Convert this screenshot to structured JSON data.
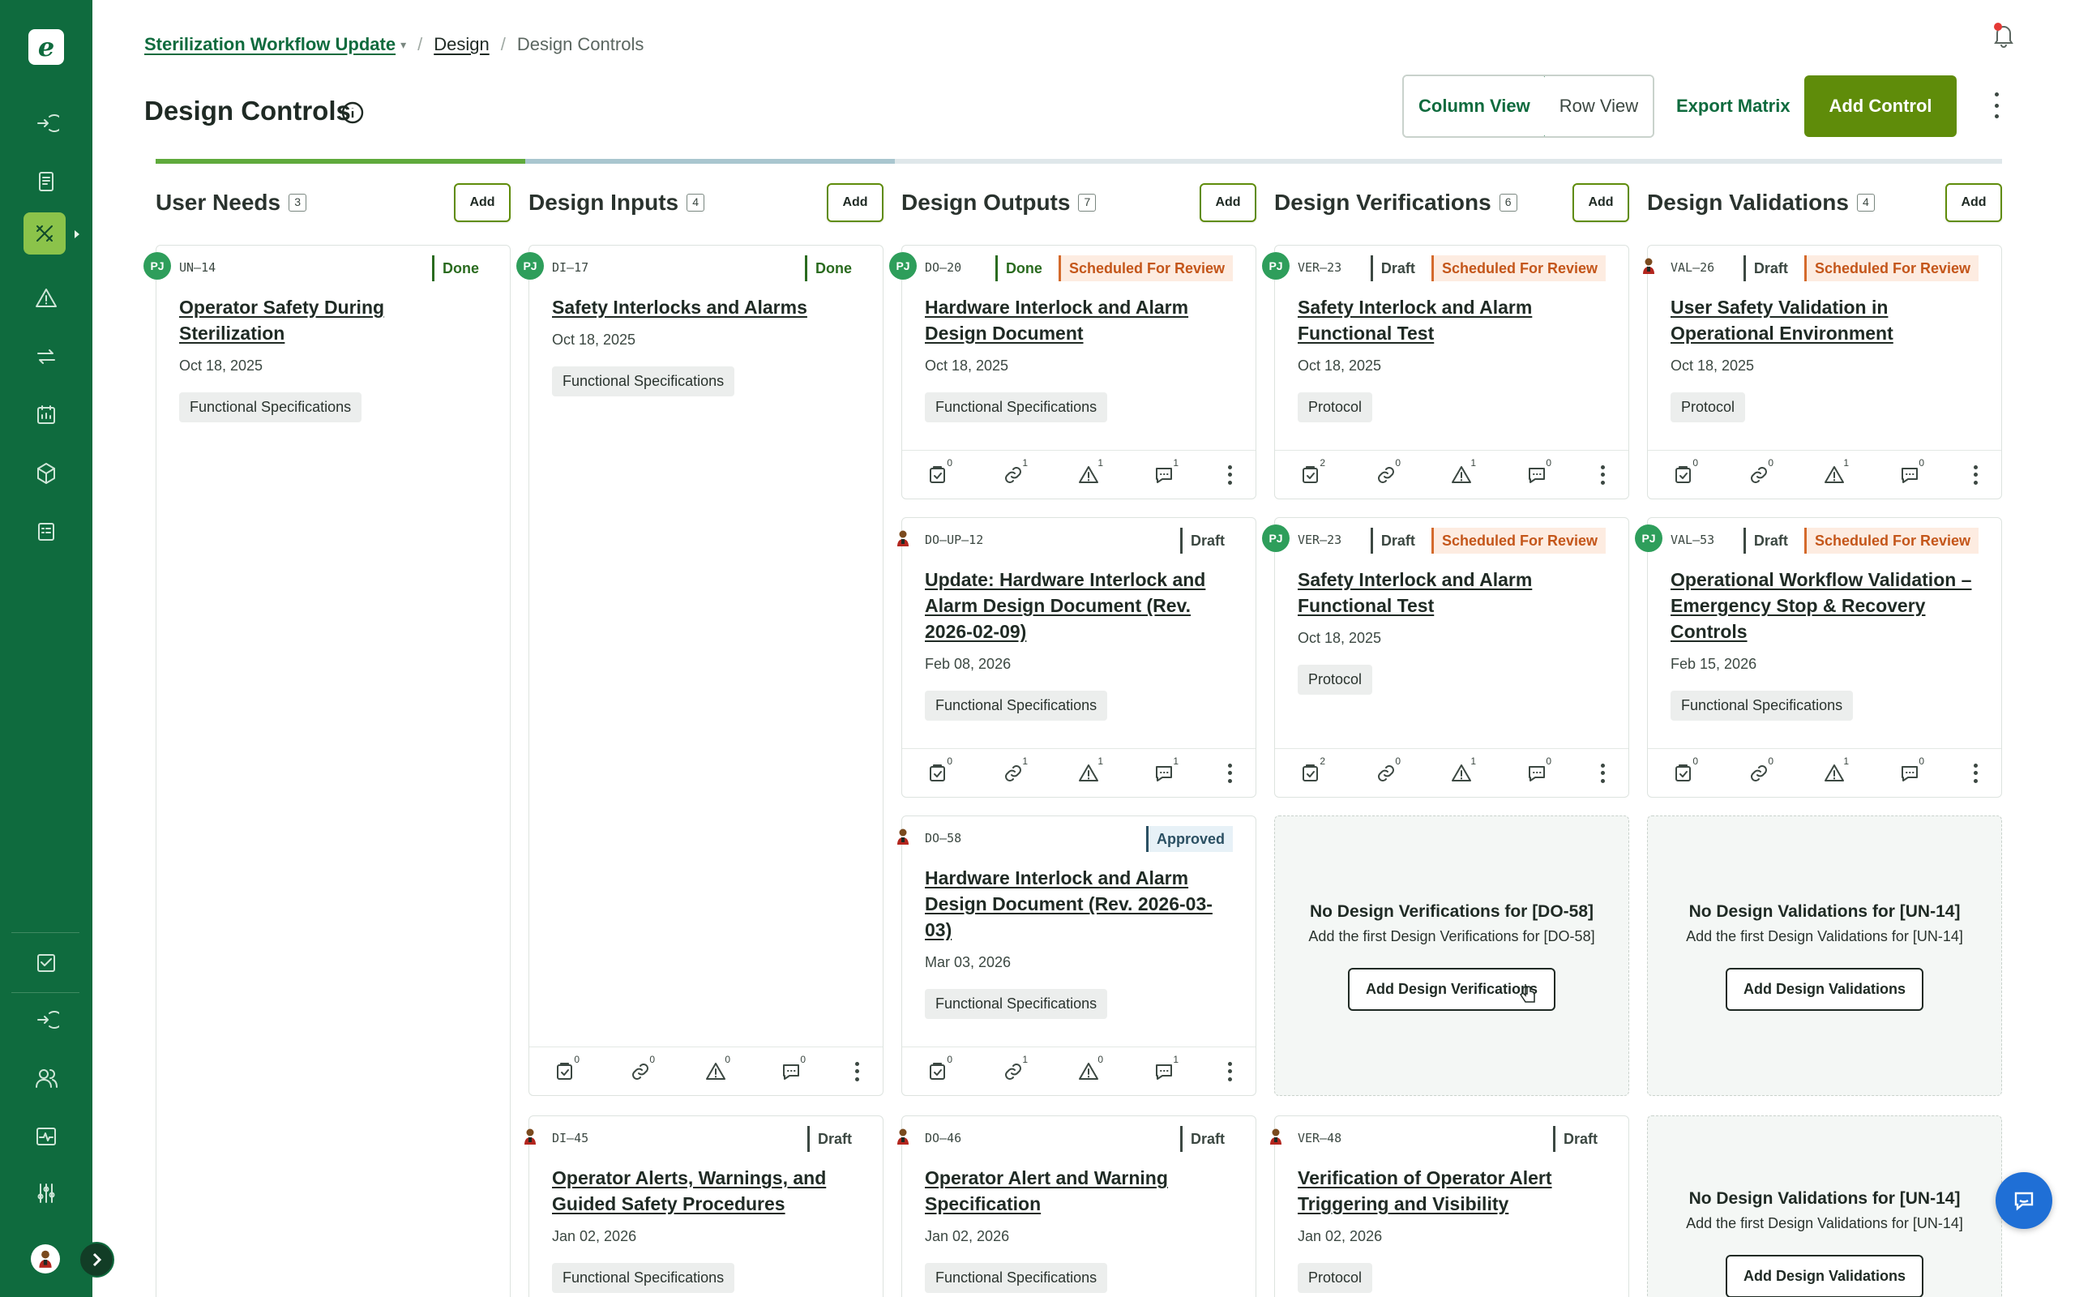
{
  "app": {
    "logo_letter": "e",
    "colors": {
      "sidebar": "#0f6b3e",
      "accent": "#5f8c0a",
      "review": "#d46a2c"
    }
  },
  "breadcrumb": {
    "project": "Sterilization Workflow Update",
    "section": "Design",
    "current": "Design Controls"
  },
  "header": {
    "title": "Design Controls",
    "column_view": "Column View",
    "row_view": "Row View",
    "export": "Export Matrix",
    "add_control": "Add Control"
  },
  "columns": [
    {
      "title": "User Needs",
      "count": "3",
      "add": "Add"
    },
    {
      "title": "Design Inputs",
      "count": "4",
      "add": "Add"
    },
    {
      "title": "Design Outputs",
      "count": "7",
      "add": "Add"
    },
    {
      "title": "Design Verifications",
      "count": "6",
      "add": "Add"
    },
    {
      "title": "Design Validations",
      "count": "4",
      "add": "Add"
    }
  ],
  "cards": {
    "un14": {
      "avatar": "PJ",
      "id": "UN–14",
      "status": "Done",
      "title": "Operator Safety During Sterilization",
      "date": "Oct 18, 2025",
      "tag": "Functional Specifications"
    },
    "di17": {
      "avatar": "PJ",
      "id": "DI–17",
      "status": "Done",
      "title": "Safety Interlocks and Alarms",
      "date": "Oct 18, 2025",
      "tag": "Functional Specifications",
      "counts": [
        "0",
        "0",
        "0",
        "0"
      ]
    },
    "di45": {
      "id": "DI–45",
      "status": "Draft",
      "title": "Operator Alerts, Warnings, and Guided Safety Procedures",
      "date": "Jan 02, 2026",
      "tag": "Functional Specifications"
    },
    "do20": {
      "avatar": "PJ",
      "id": "DO–20",
      "status": "Done",
      "review": "Scheduled For Review",
      "title": "Hardware Interlock and Alarm Design Document",
      "date": "Oct 18, 2025",
      "tag": "Functional Specifications",
      "counts": [
        "0",
        "1",
        "1",
        "1"
      ]
    },
    "doup12": {
      "id": "DO–UP–12",
      "status": "Draft",
      "title": "Update: Hardware Interlock and Alarm Design Document (Rev. 2026-02-09)",
      "date": "Feb 08, 2026",
      "tag": "Functional Specifications",
      "counts": [
        "0",
        "1",
        "1",
        "1"
      ]
    },
    "do58": {
      "id": "DO–58",
      "status": "Approved",
      "title": "Hardware Interlock and Alarm Design Document (Rev. 2026-03-03)",
      "date": "Mar 03, 2026",
      "tag": "Functional Specifications",
      "counts": [
        "0",
        "1",
        "0",
        "1"
      ]
    },
    "do46": {
      "id": "DO–46",
      "status": "Draft",
      "title": "Operator Alert and Warning Specification",
      "date": "Jan 02, 2026",
      "tag": "Functional Specifications"
    },
    "ver23a": {
      "avatar": "PJ",
      "id": "VER–23",
      "status": "Draft",
      "review": "Scheduled For Review",
      "title": "Safety Interlock and Alarm Functional Test",
      "date": "Oct 18, 2025",
      "tag": "Protocol",
      "counts": [
        "2",
        "0",
        "1",
        "0"
      ]
    },
    "ver23b": {
      "avatar": "PJ",
      "id": "VER–23",
      "status": "Draft",
      "review": "Scheduled For Review",
      "title": "Safety Interlock and Alarm Functional Test",
      "date": "Oct 18, 2025",
      "tag": "Protocol",
      "counts": [
        "2",
        "0",
        "1",
        "0"
      ]
    },
    "ver48": {
      "id": "VER–48",
      "status": "Draft",
      "title": "Verification of Operator Alert Triggering and Visibility",
      "date": "Jan 02, 2026",
      "tag": "Protocol"
    },
    "val26": {
      "id": "VAL–26",
      "status": "Draft",
      "review": "Scheduled For Review",
      "title": "User Safety Validation in Operational Environment",
      "date": "Oct 18, 2025",
      "tag": "Protocol",
      "counts": [
        "0",
        "0",
        "1",
        "0"
      ]
    },
    "val53": {
      "avatar": "PJ",
      "id": "VAL–53",
      "status": "Draft",
      "review": "Scheduled For Review",
      "title": "Operational Workflow Validation – Emergency Stop & Recovery Controls",
      "date": "Feb 15, 2026",
      "tag": "Functional Specifications",
      "counts": [
        "0",
        "0",
        "1",
        "0"
      ]
    }
  },
  "empties": {
    "ver_do58": {
      "title": "No Design Verifications for [DO-58]",
      "sub": "Add the first Design Verifications for [DO-58]",
      "button": "Add Design Verifications"
    },
    "val_un14_a": {
      "title": "No Design Validations for [UN-14]",
      "sub": "Add the first Design Validations for [UN-14]",
      "button": "Add Design Validations"
    },
    "val_un14_b": {
      "title": "No Design Validations for [UN-14]",
      "sub": "Add the first Design Validations for [UN-14]",
      "button": "Add Design Validations"
    }
  }
}
